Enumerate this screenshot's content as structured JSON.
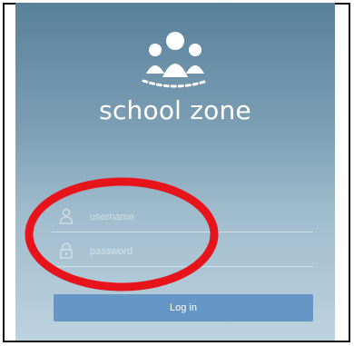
{
  "app": {
    "brand_name": "school zone",
    "logo_icon": "people-group-icon"
  },
  "login": {
    "username_placeholder": "username",
    "password_placeholder": "password",
    "username_icon": "user-icon",
    "password_icon": "lock-icon",
    "login_label": "Log in"
  },
  "annotation": {
    "highlight_color": "#e8141c",
    "shape": "ellipse"
  },
  "colors": {
    "button": "#6496c6",
    "background_top": "#59819a",
    "background_bottom": "#bdd2df"
  }
}
